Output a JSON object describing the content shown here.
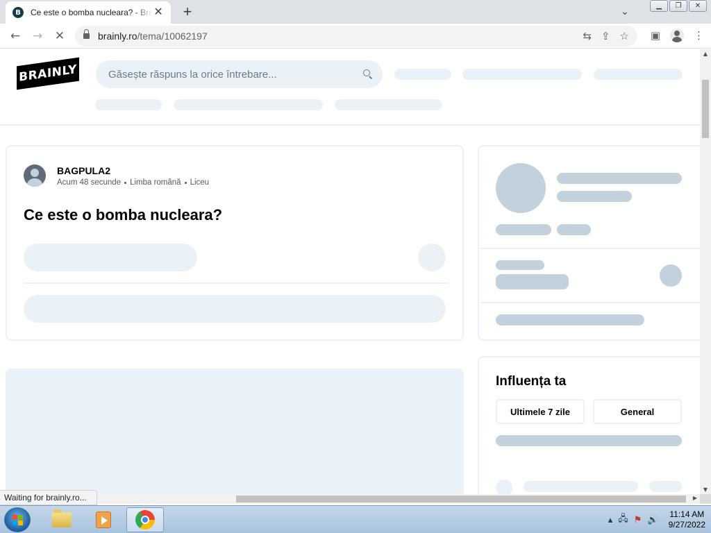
{
  "browser": {
    "tab_title": "Ce este o bomba nucleara? - Brainly.ro",
    "tab_close": "✕",
    "new_tab": "+",
    "tab_list": "⌄",
    "url_domain": "brainly.ro",
    "url_path": "/tema/10062197",
    "status_text": "Waiting for brainly.ro..."
  },
  "icons": {
    "favicon": "brainly-favicon-icon",
    "back": "←",
    "forward": "→",
    "stop": "✕",
    "translate": "⇆",
    "share": "⇪",
    "bookmark": "☆",
    "side_panel": "▣",
    "menu": "⋮",
    "minimize": "▁",
    "restore": "❐",
    "close": "✕"
  },
  "site": {
    "logo_text": "BRAINLY",
    "search_placeholder": "Găsește răspuns la orice întrebare..."
  },
  "question": {
    "username": "BAGPULA2",
    "time": "Acum 48 secunde",
    "subject": "Limba română",
    "level": "Liceu",
    "title": "Ce este o bomba nucleara?"
  },
  "influence": {
    "title": "Influența ta",
    "tabs": [
      "Ultimele 7 zile",
      "General"
    ]
  },
  "taskbar": {
    "time": "11:14 AM",
    "date": "9/27/2022"
  },
  "colors": {
    "skeleton_light": "#ebf2f7",
    "skeleton_dark": "#c3d1dd",
    "brand": "#000000"
  }
}
